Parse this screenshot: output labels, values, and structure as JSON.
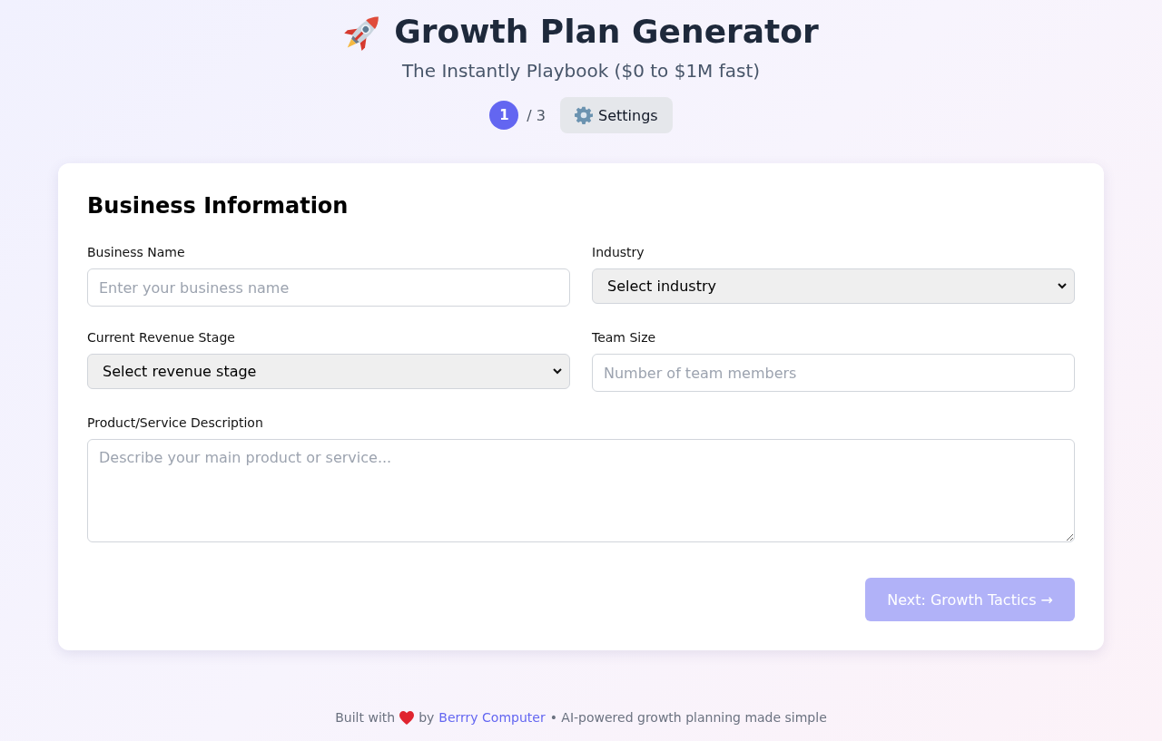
{
  "header": {
    "title": "Growth Plan Generator",
    "subtitle": "The Instantly Playbook ($0 to $1M fast)"
  },
  "steps": {
    "current": "1",
    "total": "/ 3",
    "settings_button": "Settings"
  },
  "form": {
    "title": "Business Information",
    "fields": [
      {
        "kind": "text",
        "label": "Business Name",
        "placeholder": "Enter your business name"
      },
      {
        "kind": "select",
        "label": "Industry",
        "value": "Select industry"
      },
      {
        "kind": "select",
        "label": "Current Revenue Stage",
        "value": "Select revenue stage"
      },
      {
        "kind": "text",
        "label": "Team Size",
        "placeholder": "Number of team members"
      },
      {
        "kind": "textarea",
        "label": "Product/Service Description",
        "placeholder": "Describe your main product or service..."
      }
    ],
    "next_button": {
      "label": "Next: Growth Tactics →",
      "disabled": true
    }
  },
  "footer": {
    "before": "Built with",
    "middle": "by",
    "link": "Berrry Computer",
    "after": "• AI-powered growth planning made simple"
  }
}
